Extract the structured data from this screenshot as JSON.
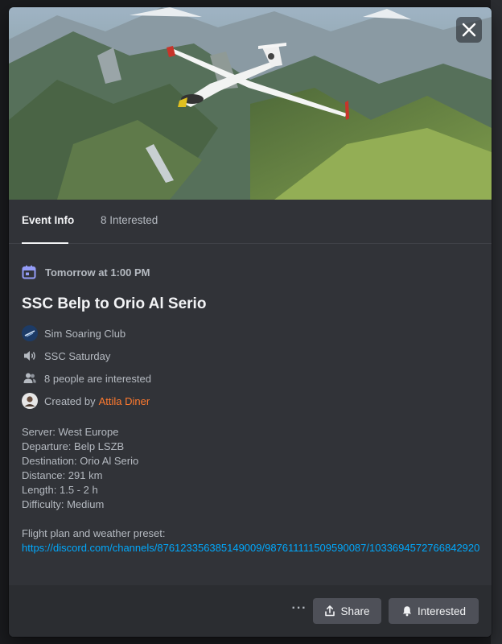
{
  "event": {
    "when": "Tomorrow at 1:00 PM",
    "title": "SSC Belp to Orio Al Serio",
    "server_name": "Sim Soaring Club",
    "channel": "SSC Saturday",
    "interested_text": "8 people are interested",
    "created_by_prefix": "Created by",
    "creator": "Attila Diner"
  },
  "tabs": [
    {
      "label": "Event Info",
      "active": true
    },
    {
      "label": "8 Interested",
      "active": false
    }
  ],
  "description": {
    "lines": [
      "Server: West Europe",
      "Departure: Belp LSZB",
      "Destination: Orio Al Serio",
      "Distance: 291 km",
      "Length: 1.5 - 2 h",
      "Difficulty: Medium"
    ],
    "preset_label": "Flight plan and weather preset:",
    "link": "https://discord.com/channels/876123356385149009/987611111509590087/1033694572766842920"
  },
  "footer": {
    "more": "···",
    "share_label": "Share",
    "interested_label": "Interested"
  },
  "colors": {
    "accent_link": "#00a8fc",
    "creator_color": "#ff7a2f",
    "calendar_icon": "#949cf7"
  },
  "icons": {
    "close": "close-icon",
    "calendar": "calendar-icon",
    "server": "server-avatar",
    "channel": "speaker-icon",
    "people": "people-icon",
    "creator_avatar": "avatar",
    "share": "share-icon",
    "bell": "bell-icon"
  }
}
